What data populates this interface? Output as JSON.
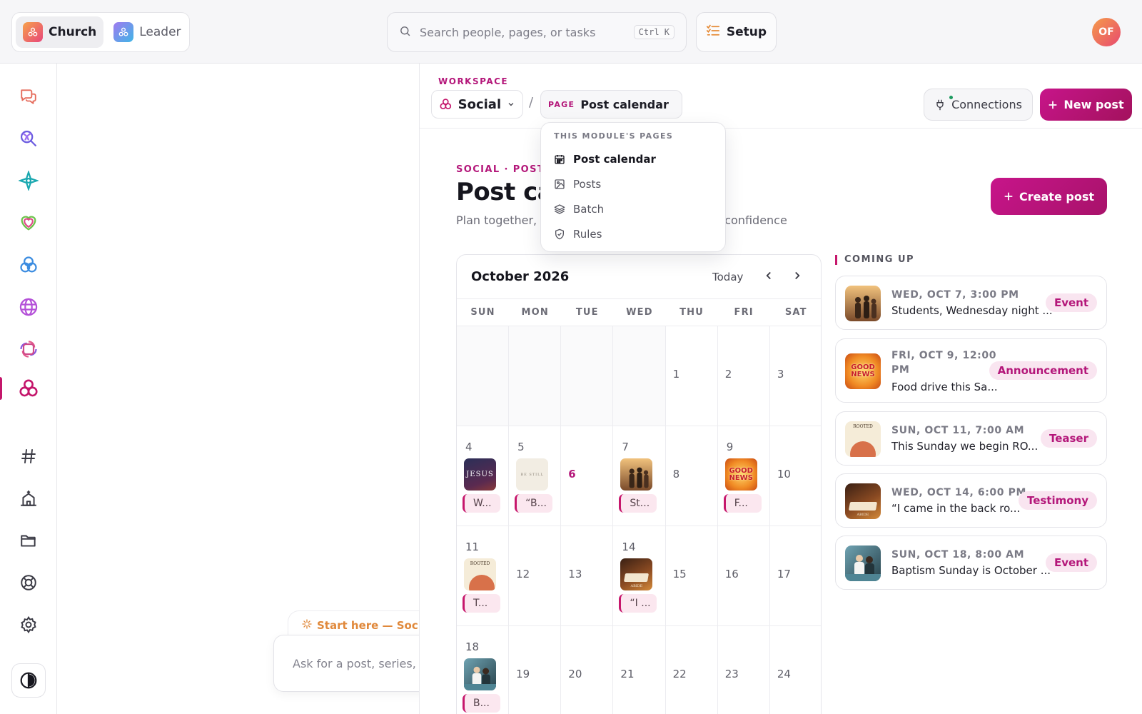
{
  "topbar": {
    "switcher": [
      {
        "label": "Church",
        "active": true
      },
      {
        "label": "Leader",
        "active": false
      }
    ],
    "search_placeholder": "Search people, pages, or tasks",
    "search_shortcut": "Ctrl K",
    "setup_label": "Setup",
    "avatar_initials": "OF"
  },
  "rail": {
    "icons": [
      "chat-icon",
      "search-people-icon",
      "compass-icon",
      "heart-icon",
      "knot-icon",
      "globe-icon",
      "flower-icon",
      "social-icon",
      "hashtag-icon",
      "church-building-icon",
      "folder-icon",
      "lifebuoy-icon",
      "settings-icon",
      "theme-icon"
    ],
    "active": "social-icon"
  },
  "assistant": {
    "start_here": "Start here — Socia",
    "ask_placeholder": "Ask for a post, series,"
  },
  "header": {
    "workspace_label": "WORKSPACE",
    "workspace_name": "Social",
    "separator": "/",
    "page_tag": "PAGE",
    "page_name": "Post calendar",
    "connections_label": "Connections",
    "new_post_label": "New post"
  },
  "dropdown": {
    "title": "THIS MODULE'S PAGES",
    "items": [
      {
        "label": "Post calendar",
        "icon": "calendar-icon",
        "current": true
      },
      {
        "label": "Posts",
        "icon": "image-icon",
        "current": false
      },
      {
        "label": "Batch",
        "icon": "layers-icon",
        "current": false
      },
      {
        "label": "Rules",
        "icon": "shield-icon",
        "current": false
      }
    ]
  },
  "page": {
    "kicker": "SOCIAL · POST",
    "title": "Post cal",
    "subtitle": "Plan together,                                              n confidence",
    "subtitle_left": "Plan together,",
    "subtitle_right": "n confidence",
    "create_label": "Create post"
  },
  "calendar": {
    "month_label": "October 2026",
    "today_label": "Today",
    "weekdays": [
      "SUN",
      "MON",
      "TUE",
      "WED",
      "THU",
      "FRI",
      "SAT"
    ],
    "weeks": [
      [
        null,
        null,
        null,
        null,
        {
          "day": "1"
        },
        {
          "day": "2"
        },
        {
          "day": "3"
        }
      ],
      [
        {
          "day": "4",
          "thumb": "jesus",
          "chip": "W..."
        },
        {
          "day": "5",
          "thumb": "beige",
          "chip": "“B..."
        },
        {
          "day": "6",
          "today": true
        },
        {
          "day": "7",
          "thumb": "students",
          "chip": "St..."
        },
        {
          "day": "8"
        },
        {
          "day": "9",
          "thumb": "goodnews",
          "chip": "F..."
        },
        {
          "day": "10"
        }
      ],
      [
        {
          "day": "11",
          "thumb": "rooted",
          "chip": "T..."
        },
        {
          "day": "12"
        },
        {
          "day": "13"
        },
        {
          "day": "14",
          "thumb": "abide",
          "chip": "“I ..."
        },
        {
          "day": "15"
        },
        {
          "day": "16"
        },
        {
          "day": "17"
        }
      ],
      [
        {
          "day": "18",
          "thumb": "baptism",
          "chip": "B..."
        },
        {
          "day": "19"
        },
        {
          "day": "20"
        },
        {
          "day": "21"
        },
        {
          "day": "22"
        },
        {
          "day": "23"
        },
        {
          "day": "24"
        }
      ]
    ]
  },
  "coming_up": {
    "title": "COMING UP",
    "items": [
      {
        "date": "WED, OCT 7, 3:00 PM",
        "text": "Students, Wednesday night ...",
        "badge": "Event",
        "thumb": "students"
      },
      {
        "date_line1": "FRI, OCT 9, 12:00",
        "date_line2": "PM",
        "text": "Food drive this Sa...",
        "badge": "Announcement",
        "thumb": "goodnews"
      },
      {
        "date": "SUN, OCT 11, 7:00 AM",
        "text": "This Sunday we begin RO...",
        "badge": "Teaser",
        "thumb": "rooted"
      },
      {
        "date": "WED, OCT 14, 6:00 PM",
        "text": "“I came in the back ro...",
        "badge": "Testimony",
        "thumb": "abide"
      },
      {
        "date": "SUN, OCT 18, 8:00 AM",
        "text": "Baptism Sunday is October ...",
        "badge": "Event",
        "thumb": "baptism"
      }
    ]
  },
  "thumb_text": {
    "jesus": "JESUS",
    "beige": "BE STILL",
    "goodnews_1": "GOOD",
    "goodnews_2": "NEWS",
    "rooted": "ROOTED",
    "abide": "ABIDE"
  },
  "colors": {
    "accent": "#b4177a",
    "accent_dark": "#a3125d",
    "chip_bg": "#fbe7ef",
    "badge_bg": "#f9e5f0",
    "online": "#1d9a5f"
  }
}
